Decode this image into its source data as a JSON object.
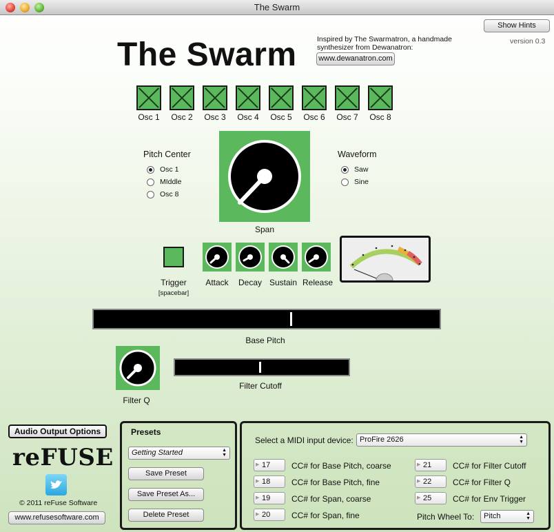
{
  "window": {
    "title": "The Swarm"
  },
  "header": {
    "app_title": "The Swarm",
    "inspired_text": "Inspired by The Swarmatron, a handmade synthesizer from Dewanatron:",
    "dewanatron_link": "www.dewanatron.com",
    "show_hints": "Show Hints",
    "version": "version 0.3"
  },
  "oscillators": [
    {
      "label": "Osc 1",
      "enabled": true
    },
    {
      "label": "Osc 2",
      "enabled": true
    },
    {
      "label": "Osc 3",
      "enabled": true
    },
    {
      "label": "Osc 4",
      "enabled": true
    },
    {
      "label": "Osc 5",
      "enabled": true
    },
    {
      "label": "Osc 6",
      "enabled": true
    },
    {
      "label": "Osc 7",
      "enabled": true
    },
    {
      "label": "Osc 8",
      "enabled": true
    }
  ],
  "pitch_center": {
    "label": "Pitch Center",
    "options": [
      "Osc 1",
      "MIddle",
      "Osc 8"
    ],
    "selected": "Osc 1"
  },
  "span": {
    "label": "Span"
  },
  "waveform": {
    "label": "Waveform",
    "options": [
      "Saw",
      "Sine"
    ],
    "selected": "Saw"
  },
  "trigger": {
    "label": "Trigger",
    "hint": "[spacebar]"
  },
  "envelope": {
    "attack": "Attack",
    "decay": "Decay",
    "sustain": "Sustain",
    "release": "Release"
  },
  "base_pitch": {
    "label": "Base Pitch",
    "value_fraction": 0.57
  },
  "filter_q": {
    "label": "Filter Q"
  },
  "filter_cutoff": {
    "label": "Filter Cutoff",
    "value_fraction": 0.49
  },
  "audio": {
    "output_options": "Audio Output Options"
  },
  "brand": {
    "logo": "reFUSE",
    "copyright": "© 2011 reFuse Software",
    "website": "www.refusesoftware.com"
  },
  "presets": {
    "title": "Presets",
    "selected": "Getting Started",
    "save": "Save Preset",
    "save_as": "Save Preset As...",
    "delete": "Delete Preset"
  },
  "midi": {
    "device_label": "Select a MIDI input device:",
    "device": "ProFire 2626",
    "cc_left": [
      {
        "value": "17",
        "label": "CC# for Base Pitch, coarse"
      },
      {
        "value": "18",
        "label": "CC# for Base Pitch, fine"
      },
      {
        "value": "19",
        "label": "CC# for Span, coarse"
      },
      {
        "value": "20",
        "label": "CC# for Span, fine"
      }
    ],
    "cc_right": [
      {
        "value": "21",
        "label": "CC# for Filter Cutoff"
      },
      {
        "value": "22",
        "label": "CC# for Filter Q"
      },
      {
        "value": "25",
        "label": "CC# for Env Trigger"
      }
    ],
    "pitch_wheel_label": "Pitch Wheel To:",
    "pitch_wheel_value": "Pitch"
  },
  "colors": {
    "accent_green": "#5cb85c",
    "panel_border": "#1a1a1a"
  }
}
